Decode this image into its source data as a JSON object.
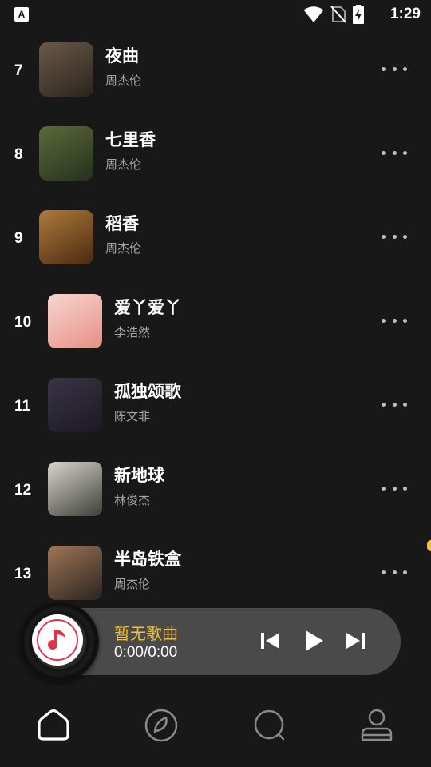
{
  "status_bar": {
    "app_icon_letter": "A",
    "time": "1:29",
    "icons": [
      "wifi-icon",
      "no-sim-icon",
      "battery-charging-icon"
    ]
  },
  "songs": [
    {
      "rank": "7",
      "title": "夜曲",
      "artist": "周杰伦",
      "cover_colors": [
        "#6a5a48",
        "#2b241d"
      ]
    },
    {
      "rank": "8",
      "title": "七里香",
      "artist": "周杰伦",
      "cover_colors": [
        "#5c6a3c",
        "#27301c"
      ]
    },
    {
      "rank": "9",
      "title": "稻香",
      "artist": "周杰伦",
      "cover_colors": [
        "#b07a3a",
        "#4a2a12"
      ]
    },
    {
      "rank": "10",
      "title": "爱丫爱丫",
      "artist": "李浩然",
      "cover_colors": [
        "#f6d6cf",
        "#e88f86"
      ]
    },
    {
      "rank": "11",
      "title": "孤独颂歌",
      "artist": "陈文非",
      "cover_colors": [
        "#3a3446",
        "#1b1922"
      ]
    },
    {
      "rank": "12",
      "title": "新地球",
      "artist": "林俊杰",
      "cover_colors": [
        "#d9d4cc",
        "#3d3f3a"
      ]
    },
    {
      "rank": "13",
      "title": "半岛铁盒",
      "artist": "周杰伦",
      "cover_colors": [
        "#a07656",
        "#2a2420"
      ]
    }
  ],
  "player": {
    "title": "暂无歌曲",
    "time": "0:00/0:00",
    "accent_color": "#f2c037"
  },
  "nav": {
    "items": [
      "home-icon",
      "discover-leaf-icon",
      "search-icon",
      "profile-icon"
    ],
    "active": "home-icon"
  }
}
